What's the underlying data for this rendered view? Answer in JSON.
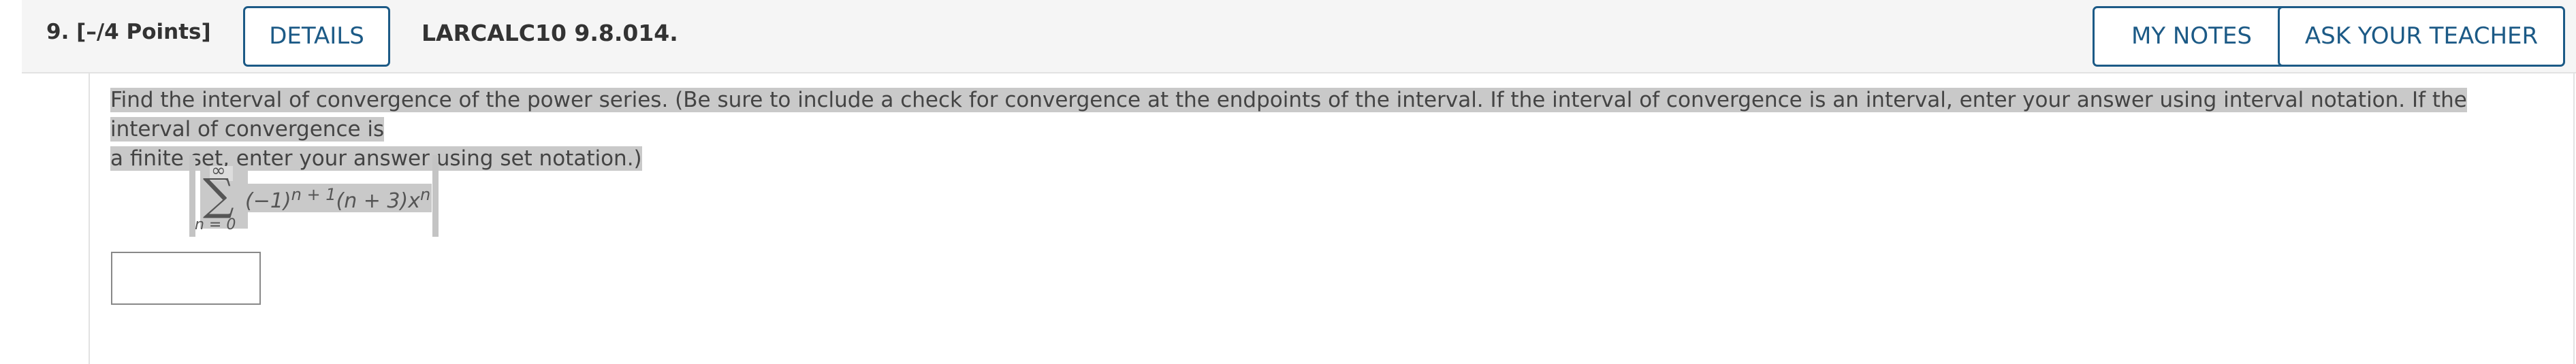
{
  "question": {
    "number": "9.",
    "points": "[–/4 Points]",
    "code": "LARCALC10 9.8.014."
  },
  "buttons": {
    "details": "DETAILS",
    "my_notes": "MY NOTES",
    "ask_teacher": "ASK YOUR TEACHER"
  },
  "prompt": {
    "line1": "Find the interval of convergence of the power series. (Be sure to include a check for convergence at the endpoints of the interval. If the interval of convergence is an interval, enter your answer using interval notation. If the interval of convergence is",
    "line2": "a finite set, enter your answer using set notation.)"
  },
  "formula": {
    "upper_limit": "∞",
    "sigma": "∑",
    "lower_limit": "n = 0",
    "term_base": "(−1)",
    "term_exponent": "n + 1",
    "term_factor": "(n + 3)x",
    "term_power": "n"
  },
  "answer": {
    "value": ""
  },
  "colors": {
    "accent": "#1c5a86",
    "header_bg": "#f5f5f5",
    "highlight": "#c9c9c9"
  }
}
